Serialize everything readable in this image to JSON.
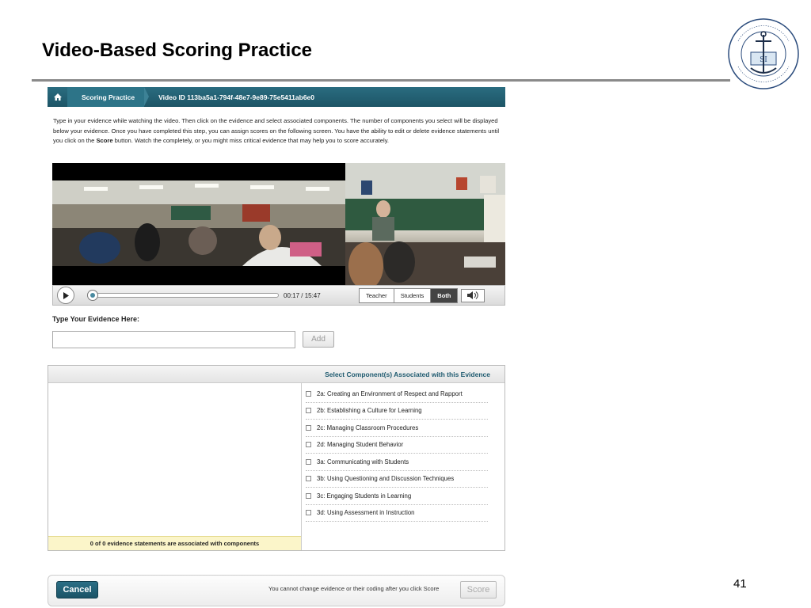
{
  "slide": {
    "title": "Video-Based Scoring Practice",
    "page_number": "41",
    "seal_text": "RHODE ISLAND BOARD OF REGENTS · ELEMENTARY AND SECONDARY EDUCATION"
  },
  "nav": {
    "crumb_1": "Scoring Practice",
    "crumb_2": "Video ID 113ba5a1-794f-48e7-9e89-75e5411ab6e0"
  },
  "instructions": {
    "part_1": "Type in your evidence while watching the video. Then click on the evidence and select associated components. The number of components you select will be displayed below your evidence. Once you have completed this step, you can assign scores on the following screen. You have the ability to edit or delete evidence statements until you click on the ",
    "bold": "Score",
    "part_2": " button. Watch the completely, or you might miss critical evidence that may help you to score accurately."
  },
  "player": {
    "time": "00:17 / 15:47",
    "progress_fraction": 0.018,
    "views": [
      "Teacher",
      "Students",
      "Both"
    ],
    "active_view": "Both"
  },
  "evidence": {
    "label": "Type Your Evidence Here:",
    "value": "",
    "add_label": "Add"
  },
  "components": {
    "heading": "Select Component(s) Associated with this Evidence",
    "items": [
      "2a: Creating an Environment of Respect and Rapport",
      "2b: Establishing a Culture for Learning",
      "2c: Managing Classroom Procedures",
      "2d: Managing Student Behavior",
      "3a: Communicating with Students",
      "3b: Using Questioning and Discussion Techniques",
      "3c: Engaging Students in Learning",
      "3d: Using Assessment in Instruction"
    ],
    "association_status": "0 of 0 evidence statements are associated with components"
  },
  "footer": {
    "cancel_label": "Cancel",
    "note": "You cannot change evidence or their coding after you click Score",
    "score_label": "Score"
  }
}
